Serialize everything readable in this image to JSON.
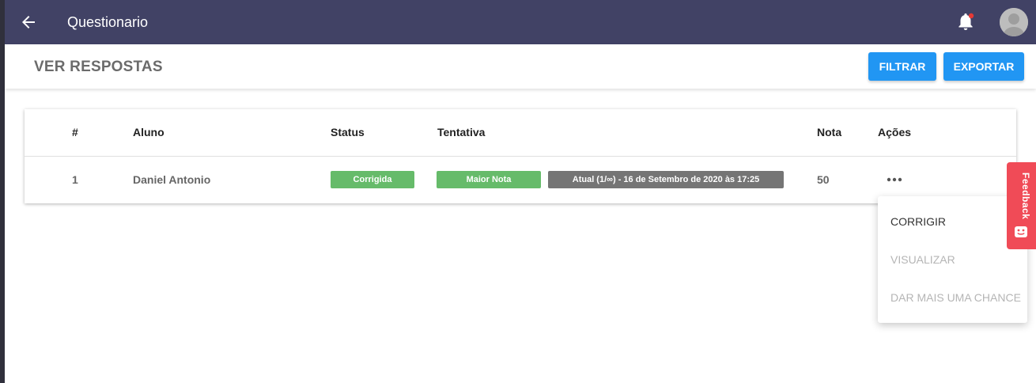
{
  "app": {
    "title": "Questionario"
  },
  "header": {
    "page_title": "VER RESPOSTAS",
    "filter_label": "FILTRAR",
    "export_label": "EXPORTAR"
  },
  "table": {
    "columns": [
      "#",
      "Aluno",
      "Status",
      "Tentativa",
      "Nota",
      "Ações"
    ],
    "rows": [
      {
        "index": "1",
        "student": "Daniel Antonio",
        "status": "Corrigida",
        "best_label": "Maior Nota",
        "attempt": "Atual (1/∞) - 16 de Setembro de 2020 às 17:25",
        "grade": "50"
      }
    ]
  },
  "menu": {
    "items": [
      "CORRIGIR",
      "VISUALIZAR",
      "DAR MAIS UMA CHANCE"
    ]
  },
  "feedback": {
    "label": "Feedback"
  },
  "colors": {
    "topbar": "#414265",
    "primary": "#2196f3",
    "success": "#66bb6a",
    "neutral": "#757575",
    "feedback": "#f04b57",
    "notification_dot": "#e53935"
  },
  "icons": {
    "back": "arrow-left-icon",
    "notifications": "bell-icon",
    "actions": "more-horizontal-icon"
  }
}
